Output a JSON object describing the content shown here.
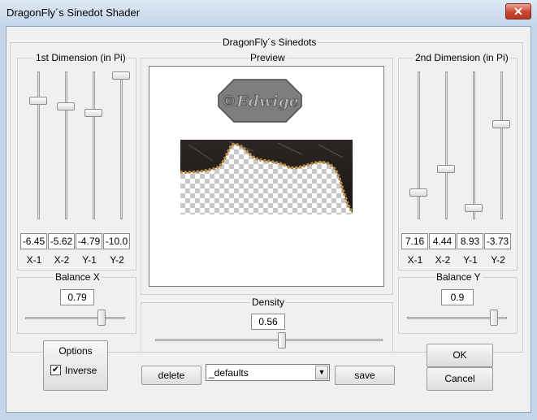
{
  "window": {
    "title": "DragonFly´s Sinedot Shader",
    "close_symbol": "✕"
  },
  "main_group": {
    "label": "DragonFly´s Sinedots"
  },
  "first_dimension": {
    "label": "1st Dimension (in Pi)",
    "sliders": [
      {
        "value": "-6.45",
        "axis": "X-1",
        "level": 0.18
      },
      {
        "value": "-5.62",
        "axis": "X-2",
        "level": 0.22
      },
      {
        "value": "-4.79",
        "axis": "Y-1",
        "level": 0.27
      },
      {
        "value": "-10.0",
        "axis": "Y-2",
        "level": 0.0
      }
    ]
  },
  "second_dimension": {
    "label": "2nd Dimension (in Pi)",
    "sliders": [
      {
        "value": "7.16",
        "axis": "X-1",
        "level": 0.84
      },
      {
        "value": "4.44",
        "axis": "X-2",
        "level": 0.67
      },
      {
        "value": "8.93",
        "axis": "Y-1",
        "level": 0.95
      },
      {
        "value": "-3.73",
        "axis": "Y-2",
        "level": 0.35
      }
    ]
  },
  "preview": {
    "label": "Preview",
    "watermark_text": "©Edwige"
  },
  "balance_x": {
    "label": "Balance X",
    "value": "0.79",
    "level": 0.79
  },
  "balance_y": {
    "label": "Balance Y",
    "value": "0.9",
    "level": 0.9
  },
  "density": {
    "label": "Density",
    "value": "0.56",
    "level": 0.56
  },
  "options": {
    "label": "Options",
    "inverse_label": "Inverse",
    "inverse_checked": true,
    "check_mark": "✔"
  },
  "presets": {
    "delete_label": "delete",
    "selected": "_defaults",
    "save_label": "save",
    "arrow": "▼"
  },
  "actions": {
    "ok_label": "OK",
    "cancel_label": "Cancel"
  }
}
